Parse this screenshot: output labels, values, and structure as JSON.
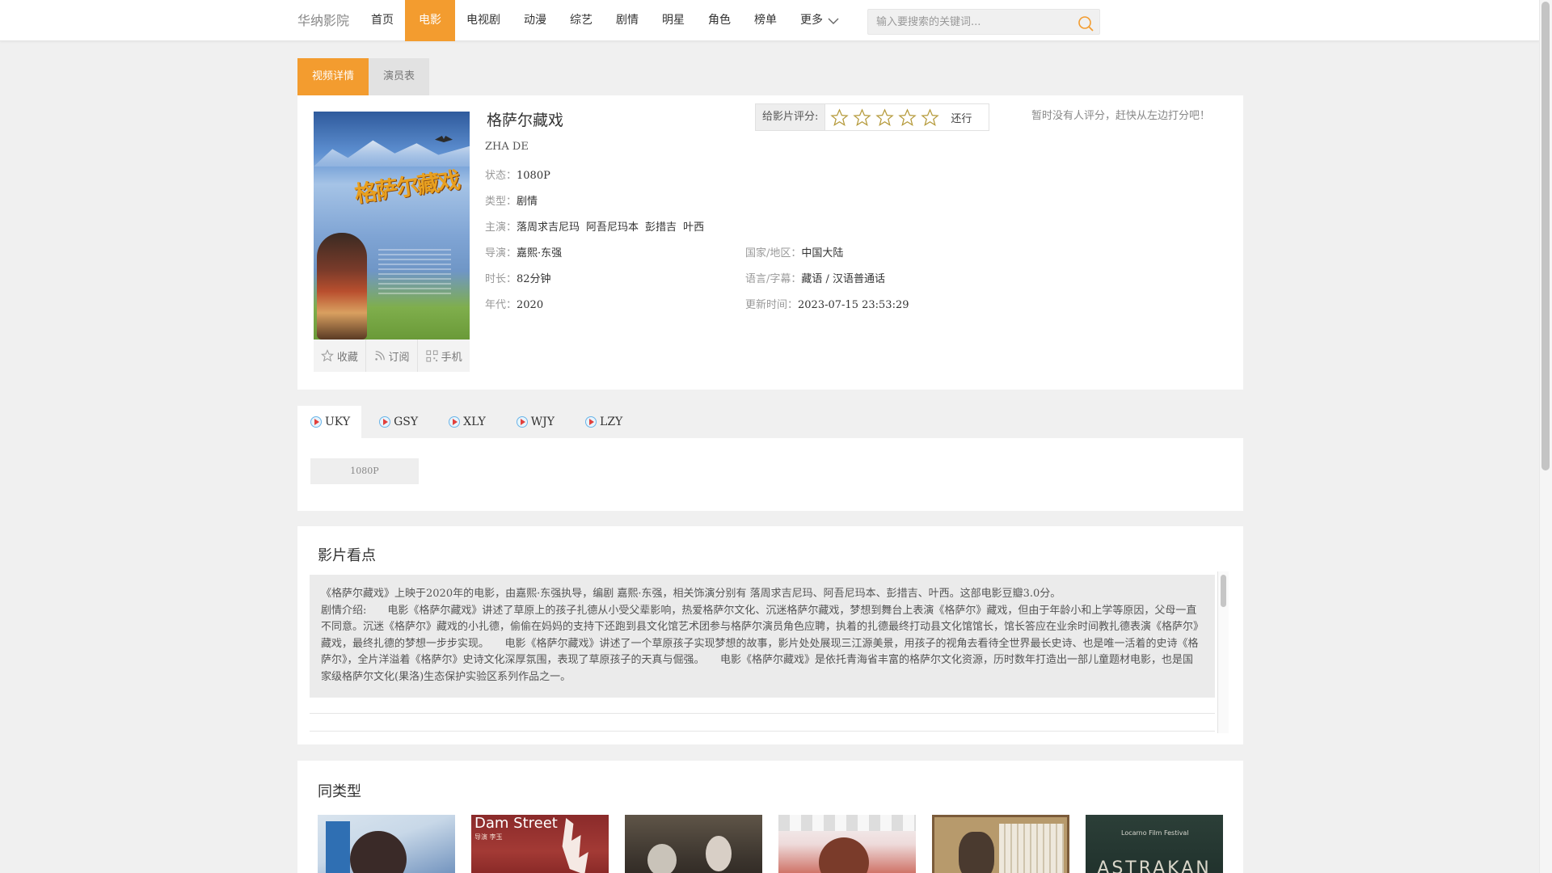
{
  "header": {
    "brand": "华纳影院",
    "nav": [
      "首页",
      "电影",
      "电视剧",
      "动漫",
      "综艺",
      "剧情",
      "明星",
      "角色",
      "榜单"
    ],
    "active_nav": "电影",
    "more_label": "更多",
    "search_placeholder": "输入要搜索的关键词..."
  },
  "tabs": {
    "detail": "视频详情",
    "cast": "演员表"
  },
  "movie": {
    "title": "格萨尔藏戏",
    "en_title": "ZHA DE",
    "poster_title": "格萨尔藏戏",
    "status_label": "状态：",
    "status": "1080P",
    "type_label": "类型：",
    "type": "剧情",
    "actors_label": "主演：",
    "actors": [
      "落周求吉尼玛",
      "阿吾尼玛本",
      "彭措吉",
      "叶西"
    ],
    "director_label": "导演：",
    "director": "嘉熙·东强",
    "region_label": "国家/地区：",
    "region": "中国大陆",
    "duration_label": "时长：",
    "duration": "82分钟",
    "language_label": "语言/字幕：",
    "language": "藏语 / 汉语普通话",
    "year_label": "年代：",
    "year": "2020",
    "updated_label": "更新时间：",
    "updated": "2023-07-15 23:53:29"
  },
  "poster_actions": {
    "favorite": "收藏",
    "subscribe": "订阅",
    "mobile": "手机"
  },
  "rating": {
    "label": "给影片评分:",
    "stars": 5,
    "word": "还行",
    "nobody": "暂时没有人评分，赶快从左边打分吧！"
  },
  "sources": [
    "UKY",
    "GSY",
    "XLY",
    "WJY",
    "LZY"
  ],
  "active_source": "UKY",
  "episodes": [
    "1080P"
  ],
  "synopsis": {
    "title": "影片看点",
    "intro": "《格萨尔藏戏》上映于2020年的电影，由嘉熙·东强执导，编剧 嘉熙·东强，相关饰演分别有 落周求吉尼玛、阿吾尼玛本、彭措吉、叶西。这部电影豆瓣3.0分。",
    "body": "剧情介绍:　　电影《格萨尔藏戏》讲述了草原上的孩子扎德从小受父辈影响，热爱格萨尔文化、沉迷格萨尔藏戏，梦想到舞台上表演《格萨尔》藏戏，但由于年龄小和上学等原因，父母一直不同意。沉迷《格萨尔》藏戏的小扎德，偷偷在妈妈的支持下还跑到县文化馆艺术团参与格萨尔演员角色应聘，执着的扎德最终打动县文化馆馆长，馆长答应在业余时间教扎德表演《格萨尔》藏戏，最终扎德的梦想一步步实现。　　电影《格萨尔藏戏》讲述了一个草原孩子实现梦想的故事，影片处处展现三江源美景，用孩子的视角去看待全世界最长史诗、也是唯一活着的史诗《格萨尔》，全片洋溢着《格萨尔》史诗文化深厚氛围，表现了草原孩子的天真与倔强。　　电影《格萨尔藏戏》是依托青海省丰富的格萨尔文化资源，历时数年打造出一部儿童题材电影，也是国家级格萨尔文化(果洛)生态保护实验区系列作品之一。"
  },
  "similar": {
    "title": "同类型",
    "items": [
      {
        "icon": "poster-thumb-1"
      },
      {
        "icon": "poster-thumb-2",
        "text": "Dam Street",
        "subtext": "导演 李玉"
      },
      {
        "icon": "poster-thumb-3"
      },
      {
        "icon": "poster-thumb-4"
      },
      {
        "icon": "poster-thumb-5"
      },
      {
        "icon": "poster-thumb-6",
        "text": "ASTRAKAN",
        "subtext": "Locarno Film Festival"
      }
    ]
  },
  "colors": {
    "accent": "#f39c2f",
    "page_bg": "#f0f0f0"
  }
}
